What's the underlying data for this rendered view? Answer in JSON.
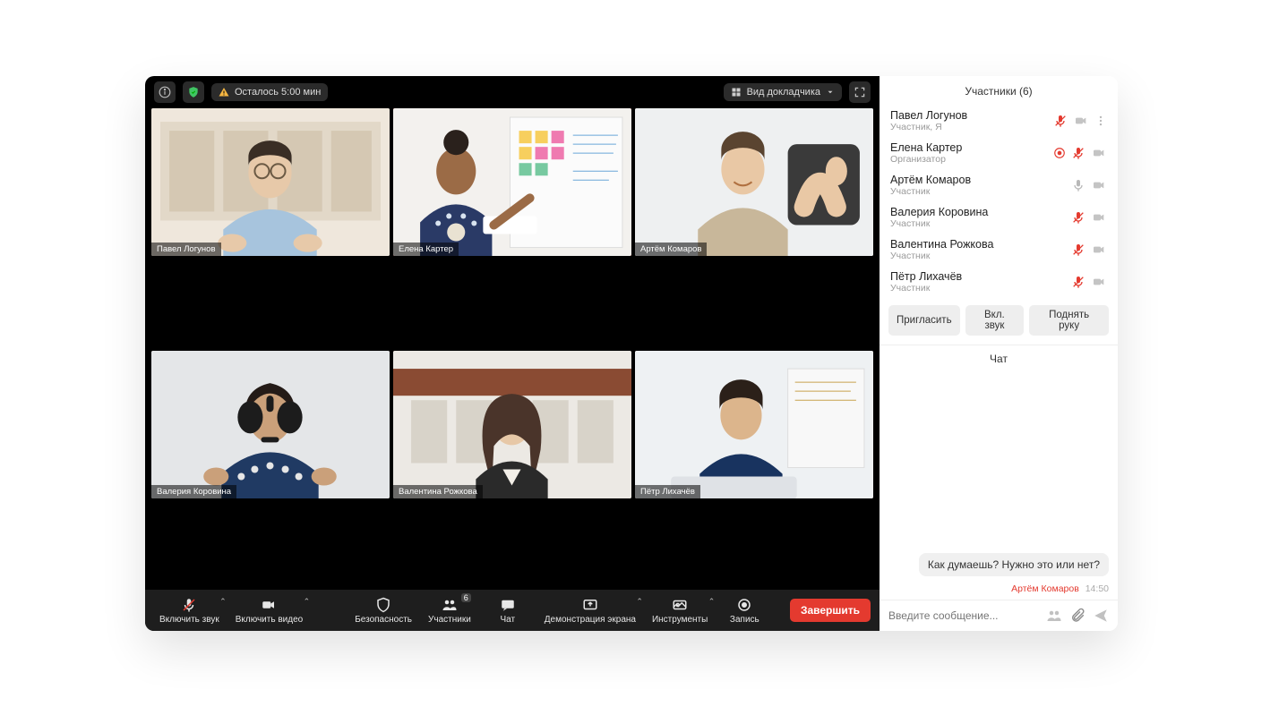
{
  "topbar": {
    "time_left": "Осталось 5:00 мин",
    "view_label": "Вид докладчика"
  },
  "tiles": [
    {
      "name": "Павел Логунов",
      "active": false
    },
    {
      "name": "Елена Картер",
      "active": true
    },
    {
      "name": "Артём Комаров",
      "active": false
    },
    {
      "name": "Валерия Коровина",
      "active": false
    },
    {
      "name": "Валентина Рожкова",
      "active": false
    },
    {
      "name": "Пётр Лихачёв",
      "active": false
    }
  ],
  "bottombar": {
    "mic": "Включить звук",
    "camera": "Включить видео",
    "security": "Безопасность",
    "participants": "Участники",
    "participants_count": "6",
    "chat": "Чат",
    "share": "Демонстрация экрана",
    "tools": "Инструменты",
    "record": "Запись",
    "end": "Завершить"
  },
  "sidebar": {
    "participants_title": "Участники (6)",
    "items": [
      {
        "name": "Павел Логунов",
        "role": "Участник, Я",
        "mic": "muted",
        "cam": "on",
        "menu": true,
        "rec": false
      },
      {
        "name": "Елена Картер",
        "role": "Организатор",
        "mic": "muted",
        "cam": "on",
        "menu": false,
        "rec": true
      },
      {
        "name": "Артём Комаров",
        "role": "Участник",
        "mic": "on",
        "cam": "on",
        "menu": false,
        "rec": false
      },
      {
        "name": "Валерия Коровина",
        "role": "Участник",
        "mic": "muted",
        "cam": "on",
        "menu": false,
        "rec": false
      },
      {
        "name": "Валентина Рожкова",
        "role": "Участник",
        "mic": "muted",
        "cam": "on",
        "menu": false,
        "rec": false
      },
      {
        "name": "Пётр Лихачёв",
        "role": "Участник",
        "mic": "muted",
        "cam": "on",
        "menu": false,
        "rec": false
      }
    ],
    "actions": {
      "invite": "Пригласить",
      "unmute": "Вкл. звук",
      "raise": "Поднять руку"
    },
    "chat_title": "Чат",
    "message": {
      "text": "Как думаешь? Нужно это или нет?",
      "author": "Артём Комаров",
      "time": "14:50"
    },
    "compose_placeholder": "Введите сообщение..."
  }
}
